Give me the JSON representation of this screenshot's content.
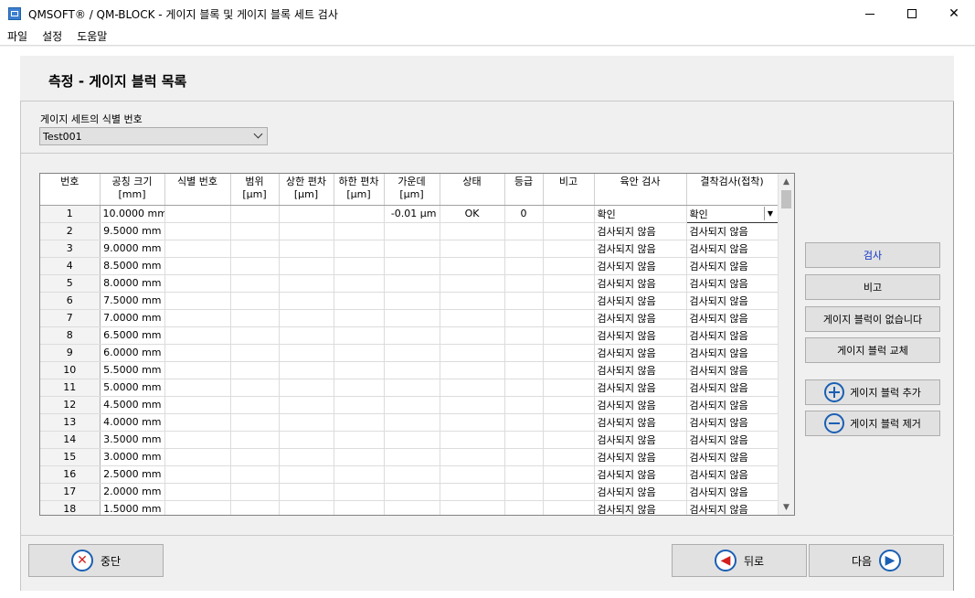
{
  "window": {
    "title": "QMSOFT® / QM-BLOCK - 게이지 블록 및 게이지 블록 세트 검사",
    "minimize": "",
    "maximize": "",
    "close": "✕"
  },
  "menu": [
    "파일",
    "설정",
    "도움말"
  ],
  "header": {
    "title": "측정 - 게이지 블럭 목록"
  },
  "gauge_set": {
    "label": "게이지 세트의 식별 번호",
    "value": "Test001"
  },
  "table": {
    "columns": [
      {
        "l1": "번호",
        "l2": ""
      },
      {
        "l1": "공칭 크기",
        "l2": "[mm]"
      },
      {
        "l1": "식별 번호",
        "l2": ""
      },
      {
        "l1": "범위",
        "l2": "[µm]"
      },
      {
        "l1": "상한 편차",
        "l2": "[µm]"
      },
      {
        "l1": "하한 편차",
        "l2": "[µm]"
      },
      {
        "l1": "가운데",
        "l2": "[µm]"
      },
      {
        "l1": "상태",
        "l2": ""
      },
      {
        "l1": "등급",
        "l2": ""
      },
      {
        "l1": "비고",
        "l2": ""
      },
      {
        "l1": "육안 검사",
        "l2": ""
      },
      {
        "l1": "결착검사(접착)",
        "l2": ""
      }
    ],
    "rows": [
      {
        "no": "1",
        "size": "10.0000 mm",
        "id": "",
        "range": "",
        "upper": "",
        "lower": "",
        "center": "-0.01 µm",
        "status": "OK",
        "grade": "0",
        "remark": "",
        "visual": "확인",
        "wringing": "확인"
      },
      {
        "no": "2",
        "size": "9.5000 mm",
        "id": "",
        "range": "",
        "upper": "",
        "lower": "",
        "center": "",
        "status": "",
        "grade": "",
        "remark": "",
        "visual": "검사되지 않음",
        "wringing": "검사되지 않음"
      },
      {
        "no": "3",
        "size": "9.0000 mm",
        "id": "",
        "range": "",
        "upper": "",
        "lower": "",
        "center": "",
        "status": "",
        "grade": "",
        "remark": "",
        "visual": "검사되지 않음",
        "wringing": "검사되지 않음"
      },
      {
        "no": "4",
        "size": "8.5000 mm",
        "id": "",
        "range": "",
        "upper": "",
        "lower": "",
        "center": "",
        "status": "",
        "grade": "",
        "remark": "",
        "visual": "검사되지 않음",
        "wringing": "검사되지 않음"
      },
      {
        "no": "5",
        "size": "8.0000 mm",
        "id": "",
        "range": "",
        "upper": "",
        "lower": "",
        "center": "",
        "status": "",
        "grade": "",
        "remark": "",
        "visual": "검사되지 않음",
        "wringing": "검사되지 않음"
      },
      {
        "no": "6",
        "size": "7.5000 mm",
        "id": "",
        "range": "",
        "upper": "",
        "lower": "",
        "center": "",
        "status": "",
        "grade": "",
        "remark": "",
        "visual": "검사되지 않음",
        "wringing": "검사되지 않음"
      },
      {
        "no": "7",
        "size": "7.0000 mm",
        "id": "",
        "range": "",
        "upper": "",
        "lower": "",
        "center": "",
        "status": "",
        "grade": "",
        "remark": "",
        "visual": "검사되지 않음",
        "wringing": "검사되지 않음"
      },
      {
        "no": "8",
        "size": "6.5000 mm",
        "id": "",
        "range": "",
        "upper": "",
        "lower": "",
        "center": "",
        "status": "",
        "grade": "",
        "remark": "",
        "visual": "검사되지 않음",
        "wringing": "검사되지 않음"
      },
      {
        "no": "9",
        "size": "6.0000 mm",
        "id": "",
        "range": "",
        "upper": "",
        "lower": "",
        "center": "",
        "status": "",
        "grade": "",
        "remark": "",
        "visual": "검사되지 않음",
        "wringing": "검사되지 않음"
      },
      {
        "no": "10",
        "size": "5.5000 mm",
        "id": "",
        "range": "",
        "upper": "",
        "lower": "",
        "center": "",
        "status": "",
        "grade": "",
        "remark": "",
        "visual": "검사되지 않음",
        "wringing": "검사되지 않음"
      },
      {
        "no": "11",
        "size": "5.0000 mm",
        "id": "",
        "range": "",
        "upper": "",
        "lower": "",
        "center": "",
        "status": "",
        "grade": "",
        "remark": "",
        "visual": "검사되지 않음",
        "wringing": "검사되지 않음"
      },
      {
        "no": "12",
        "size": "4.5000 mm",
        "id": "",
        "range": "",
        "upper": "",
        "lower": "",
        "center": "",
        "status": "",
        "grade": "",
        "remark": "",
        "visual": "검사되지 않음",
        "wringing": "검사되지 않음"
      },
      {
        "no": "13",
        "size": "4.0000 mm",
        "id": "",
        "range": "",
        "upper": "",
        "lower": "",
        "center": "",
        "status": "",
        "grade": "",
        "remark": "",
        "visual": "검사되지 않음",
        "wringing": "검사되지 않음"
      },
      {
        "no": "14",
        "size": "3.5000 mm",
        "id": "",
        "range": "",
        "upper": "",
        "lower": "",
        "center": "",
        "status": "",
        "grade": "",
        "remark": "",
        "visual": "검사되지 않음",
        "wringing": "검사되지 않음"
      },
      {
        "no": "15",
        "size": "3.0000 mm",
        "id": "",
        "range": "",
        "upper": "",
        "lower": "",
        "center": "",
        "status": "",
        "grade": "",
        "remark": "",
        "visual": "검사되지 않음",
        "wringing": "검사되지 않음"
      },
      {
        "no": "16",
        "size": "2.5000 mm",
        "id": "",
        "range": "",
        "upper": "",
        "lower": "",
        "center": "",
        "status": "",
        "grade": "",
        "remark": "",
        "visual": "검사되지 않음",
        "wringing": "검사되지 않음"
      },
      {
        "no": "17",
        "size": "2.0000 mm",
        "id": "",
        "range": "",
        "upper": "",
        "lower": "",
        "center": "",
        "status": "",
        "grade": "",
        "remark": "",
        "visual": "검사되지 않음",
        "wringing": "검사되지 않음"
      },
      {
        "no": "18",
        "size": "1.5000 mm",
        "id": "",
        "range": "",
        "upper": "",
        "lower": "",
        "center": "",
        "status": "",
        "grade": "",
        "remark": "",
        "visual": "검사되지 않음",
        "wringing": "검사되지 않음"
      }
    ]
  },
  "side_buttons": {
    "inspect": "검사",
    "remark": "비고",
    "no_block": "게이지 블럭이 없습니다",
    "replace": "게이지 블럭 교체",
    "add": "게이지 블럭 추가",
    "remove": "게이지 블럭 제거"
  },
  "footer": {
    "abort": "중단",
    "back": "뒤로",
    "next": "다음"
  },
  "icons": {
    "app": "app-icon",
    "add": "plus-circle-icon",
    "remove": "minus-circle-icon",
    "abort": "x-circle-icon",
    "back": "arrow-left-circle-icon",
    "next": "arrow-right-circle-icon"
  },
  "colors": {
    "accent": "#1a5fb4",
    "danger": "#d21f1f",
    "inspect_text": "#0a2ec8"
  }
}
